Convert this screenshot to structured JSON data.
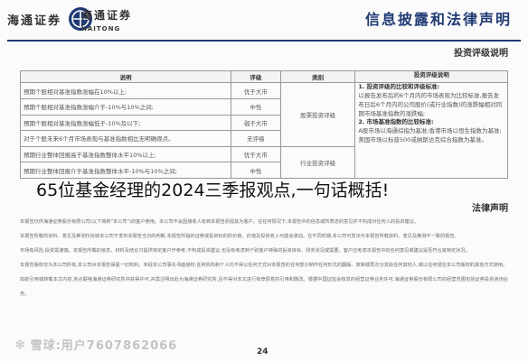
{
  "header": {
    "logo_cn": "海通证券",
    "logo_sub": "海通证券",
    "logo_en": "HAITONG",
    "doc_title": "信息披露和法律声明"
  },
  "rating": {
    "section_title": "投资评级说明",
    "headers": [
      "类别",
      "评级",
      "说明",
      "投资评级说明"
    ],
    "category": "股票投资评级",
    "rows": [
      {
        "rating": "优于大市",
        "desc": "预期个股相对基准指数涨幅在10%以上;"
      },
      {
        "rating": "中性",
        "desc": "预期个股相对基准指数涨幅介于-10%与10%之间;"
      },
      {
        "rating": "弱于大市",
        "desc": "预期个股相对基准指数涨幅低于-10%及以下;"
      },
      {
        "rating": "无评级",
        "desc": "对于个股未来6个月市场表现与基准指数相比无明确观点。"
      },
      {
        "rating": "优于大市",
        "desc": "预期行业整体回报高于基准指数整体水平10%以上;"
      },
      {
        "rating": "中性",
        "desc": "预期行业整体回报介于基准指数整体水平-10%与10%之间;"
      }
    ],
    "industry_category": "行业投资评级",
    "note_1_num": "1.",
    "note_1_title": "投资评级的比较和评级标准:",
    "note_1_text": "以报告发布后的6个月内的市场表现为比较标准,报告发布日后6个月内的公司股价(或行业指数)的涨跌幅相对同期市场基准指数的涨跌幅;",
    "note_2_num": "2.",
    "note_2_title": "市场基准指数的比较标准:",
    "note_2_text": "A股市场以海通综指为基准;香港市场以恒生指数为基准;美国市场以标普500或纳斯达克综合指数为基准。"
  },
  "legal": {
    "title": "法律声明",
    "paragraphs": [
      "本报告仅供海通证券股份有限公司(以下简称\"本公司\")的客户使用。本公司不会因接收人收到本报告而视其为客户。在任何情况下,本报告中的信息或所表述的意见并不构成对任何人的投资建议。",
      "本报告所载的资料、意见及推测仅反映本公司于发布本报告当日的判断,本报告所指的证券或投资标的的价格、价值及投资收入可能会波动。在不同时期,本公司可发出与本报告所载资料、意见及推测不一致的报告。",
      "市场有风险,投资需谨慎。本报告所载的信息、材料及结论只提供特定客户作参考,不构成投资建议,也没有考虑到个别客户特殊的投资目标、财务状况或需要。客户应考虑本报告中的任何意见或建议是否符合其特定状况。",
      "本报告版权仅为本公司所有,本公司对本报告保留一切权利。未经本公司事先书面授权,任何机构和个人均不得以任何方式对本报告的任何部分制作任何形式的翻版、复制或再次分发给任何其他人,或以任何侵犯本公司版权的其他方式使用。",
      "如欲引用或转载本文内容,务必联络海通证券研究所并获得许可,并需注明出处为海通证券研究所,且不得对本文进行有悖原意的引用和删改。根据中国证监会核发的经营证券业务许可,海通证券股份有限公司的经营范围包括证券投资咨询业务。"
    ]
  },
  "page_number": "24",
  "caption": "65位基金经理的2024三季报观点,一句话概括!",
  "watermark": {
    "icon": "snowball-icon",
    "text": "雪球:用户7607862066"
  }
}
